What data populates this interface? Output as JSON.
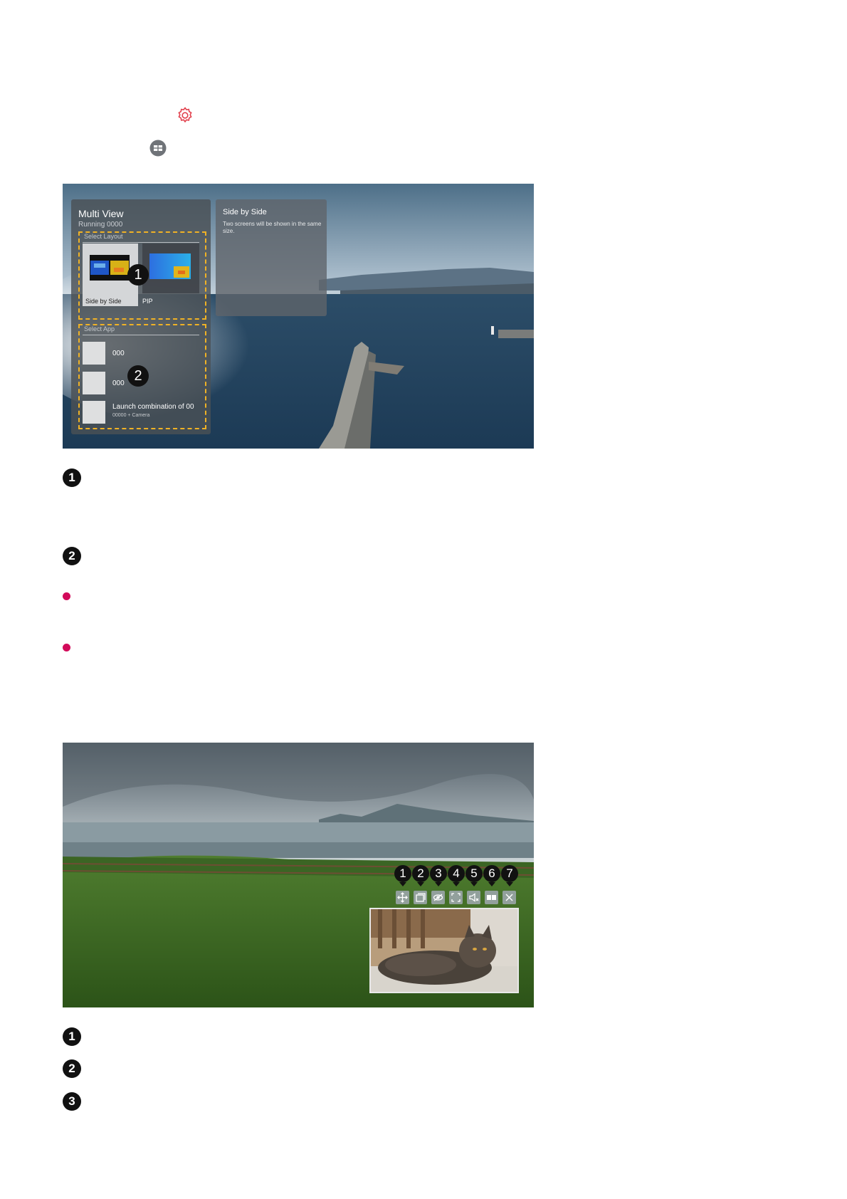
{
  "screen1": {
    "panel_title": "Multi View",
    "panel_running": "Running 0000",
    "select_layout_label": "Select Layout",
    "layouts": [
      {
        "label": "Side by Side"
      },
      {
        "label": "PIP"
      }
    ],
    "select_app_label": "Select App",
    "apps": [
      {
        "name": "000"
      },
      {
        "name": "000"
      },
      {
        "name": "Launch combination of 00",
        "sub": "00000 + Camera"
      }
    ],
    "description": {
      "title": "Side by Side",
      "text": "Two screens will be shown in the same size."
    },
    "callouts": [
      "1",
      "2"
    ]
  },
  "legend1": {
    "items": [
      "1",
      "2"
    ]
  },
  "screen2": {
    "callouts": [
      "1",
      "2",
      "3",
      "4",
      "5",
      "6",
      "7"
    ],
    "controls": [
      "move-icon",
      "swap-icon",
      "hide-icon",
      "fullscreen-icon",
      "sound-icon",
      "layout-icon",
      "close-icon"
    ]
  },
  "legend2": {
    "items": [
      "1",
      "2",
      "3"
    ]
  },
  "colors": {
    "accent_gear": "#e2414d",
    "bullet_dot": "#d20a5a",
    "dash_border": "#f0b225"
  }
}
